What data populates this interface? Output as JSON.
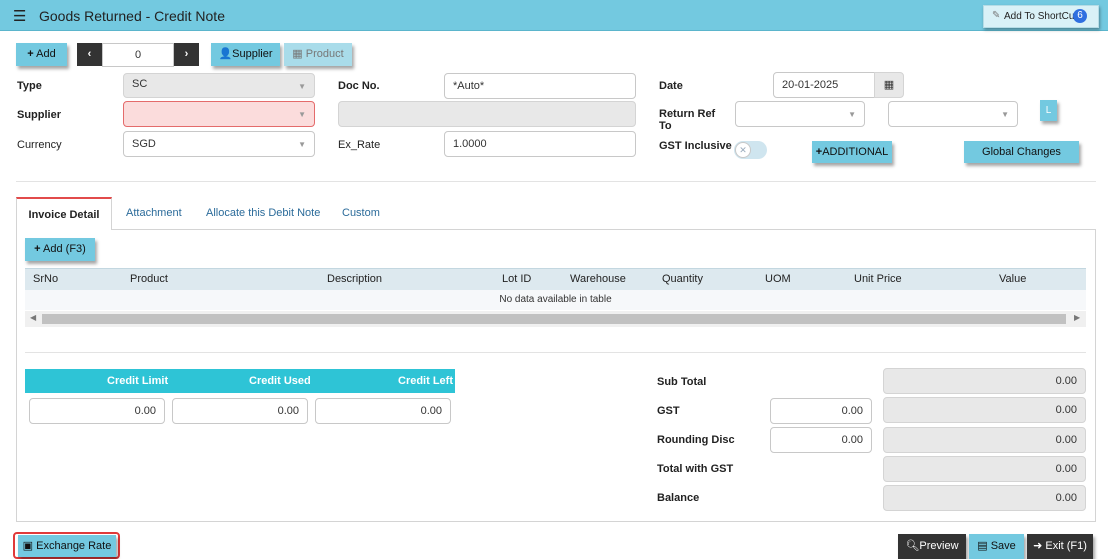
{
  "header": {
    "menu_icon": "☰",
    "title": "Goods Returned - Credit Note",
    "shortcut_label": "Add To ShortCut",
    "shortcut_count": "6"
  },
  "toolbar": {
    "add_label": "Add",
    "nav_value": "0",
    "supplier_label": "Supplier",
    "product_label": "Product"
  },
  "form": {
    "type_label": "Type",
    "type_value": "SC",
    "docno_label": "Doc No.",
    "docno_value": "*Auto*",
    "date_label": "Date",
    "date_value": "20-01-2025",
    "supplier_label": "Supplier",
    "supplier_value": "",
    "supplier_name": "",
    "return_ref_label_1": "Return Ref",
    "return_ref_label_2": "To",
    "l_badge": "L",
    "currency_label": "Currency",
    "currency_value": "SGD",
    "exrate_label": "Ex_Rate",
    "exrate_value": "1.0000",
    "gst_label": "GST Inclusive",
    "additional_label": "ADDITIONAL",
    "global_changes_label": "Global Changes"
  },
  "tabs": [
    "Invoice Detail",
    "Attachment",
    "Allocate this Debit Note",
    "Custom"
  ],
  "grid": {
    "add_label": "Add (F3)",
    "columns": [
      "SrNo",
      "Product",
      "Description",
      "Lot ID",
      "Warehouse",
      "Quantity",
      "UOM",
      "Unit Price",
      "Value"
    ],
    "empty_text": "No data available in table"
  },
  "credit": {
    "headers": [
      "Credit Limit",
      "Credit Used",
      "Credit Left"
    ],
    "values": [
      "0.00",
      "0.00",
      "0.00"
    ]
  },
  "totals": {
    "sub_total_label": "Sub Total",
    "sub_total": "0.00",
    "gst_label": "GST",
    "gst_input": "0.00",
    "gst": "0.00",
    "rounding_label": "Rounding Disc",
    "rounding_input": "0.00",
    "rounding": "0.00",
    "total_gst_label": "Total with GST",
    "total_gst": "0.00",
    "balance_label": "Balance",
    "balance": "0.00"
  },
  "footer": {
    "exchange_rate_label": "Exchange Rate",
    "preview_label": "Preview",
    "save_label": "Save",
    "exit_label": "Exit (F1)"
  }
}
